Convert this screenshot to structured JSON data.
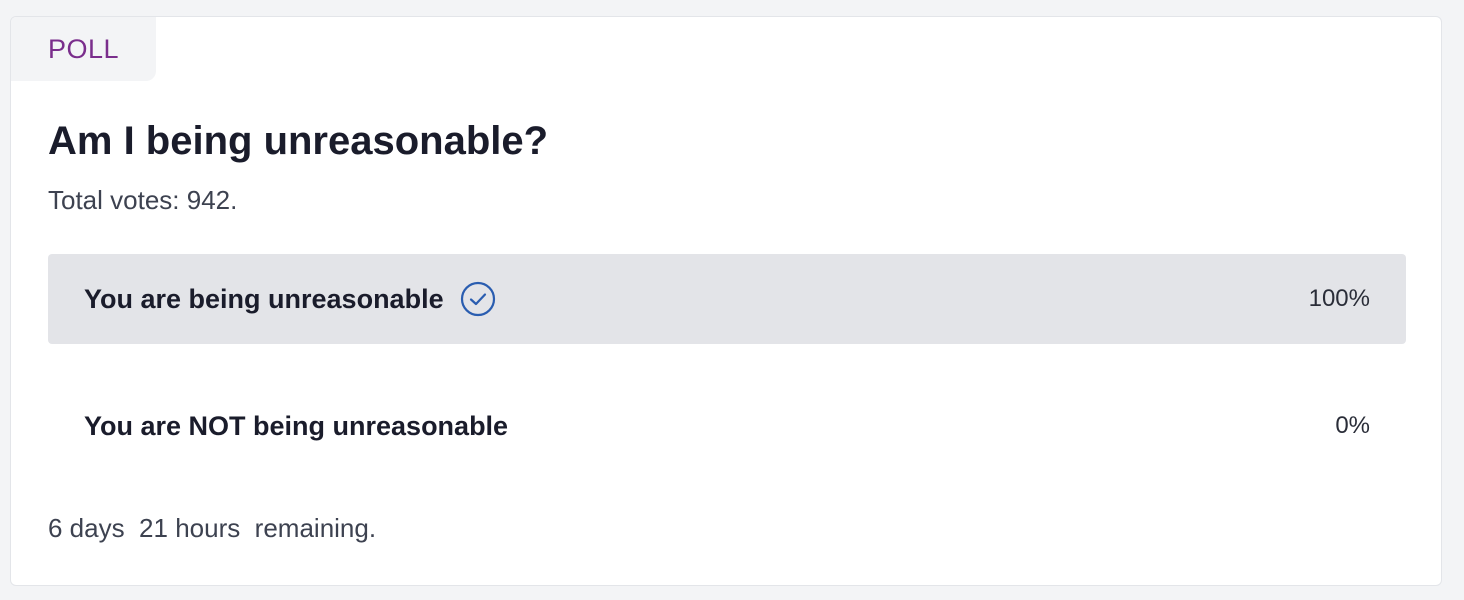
{
  "poll": {
    "tag_label": "POLL",
    "title": "Am I being unreasonable?",
    "total_votes": "Total votes: 942.",
    "options": [
      {
        "label": "You are being unreasonable",
        "percent_label": "100%",
        "percent": 100,
        "selected": true,
        "icon": "check-circle-icon"
      },
      {
        "label": "You are NOT being unreasonable",
        "percent_label": "0%",
        "percent": 0,
        "selected": false
      }
    ],
    "remaining": "6 days  21 hours  remaining."
  },
  "colors": {
    "tag_text": "#7a2e8c",
    "selected_option_bg": "#e3e4e8",
    "check_icon": "#2a5db0",
    "page_bg": "#f3f4f6"
  }
}
